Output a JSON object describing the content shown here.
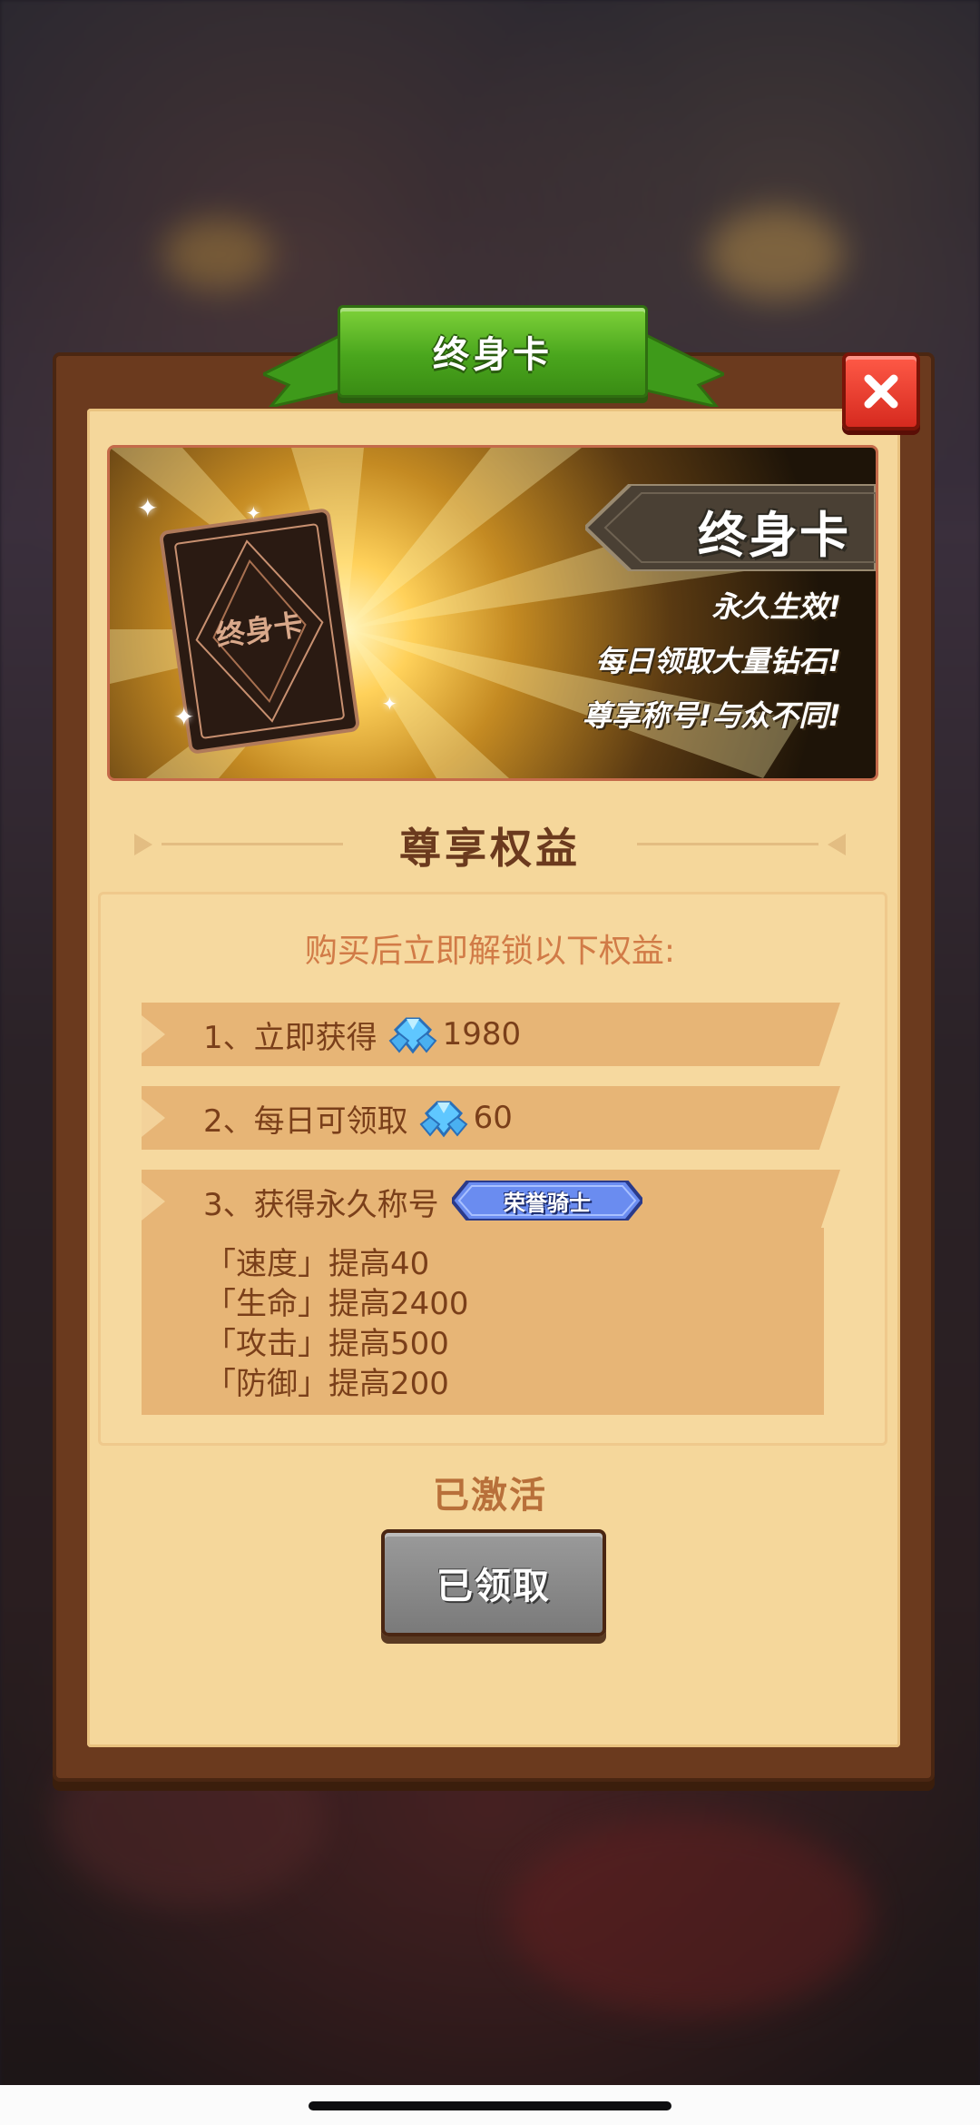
{
  "dialog": {
    "ribbon_title": "终身卡",
    "close_icon": "close-icon",
    "banner": {
      "title": "终身卡",
      "card_label": "终身卡",
      "lines": [
        "永久生效!",
        "每日领取大量钻石!",
        "尊享称号!与众不同!"
      ]
    },
    "section_title": "尊享权益",
    "intro": "购买后立即解锁以下权益:",
    "benefits": [
      {
        "label": "1、立即获得",
        "icon": "diamond-icon",
        "amount": "1980"
      },
      {
        "label": "2、每日可领取",
        "icon": "diamond-icon",
        "amount": "60"
      },
      {
        "label": "3、获得永久称号",
        "badge": "荣誉骑士"
      }
    ],
    "stats": [
      "「速度」提高40",
      "「生命」提高2400",
      "「攻击」提高500",
      "「防御」提高200"
    ],
    "status": "已激活",
    "button_label": "已领取"
  },
  "colors": {
    "panel": "#6b3a1e",
    "parchment": "#f5d79b",
    "ribbon": "#4aa61d",
    "close": "#d62a1f",
    "row": "#e7b576",
    "text_brown": "#7a3f1a",
    "button_disabled": "#8a8a8a"
  }
}
